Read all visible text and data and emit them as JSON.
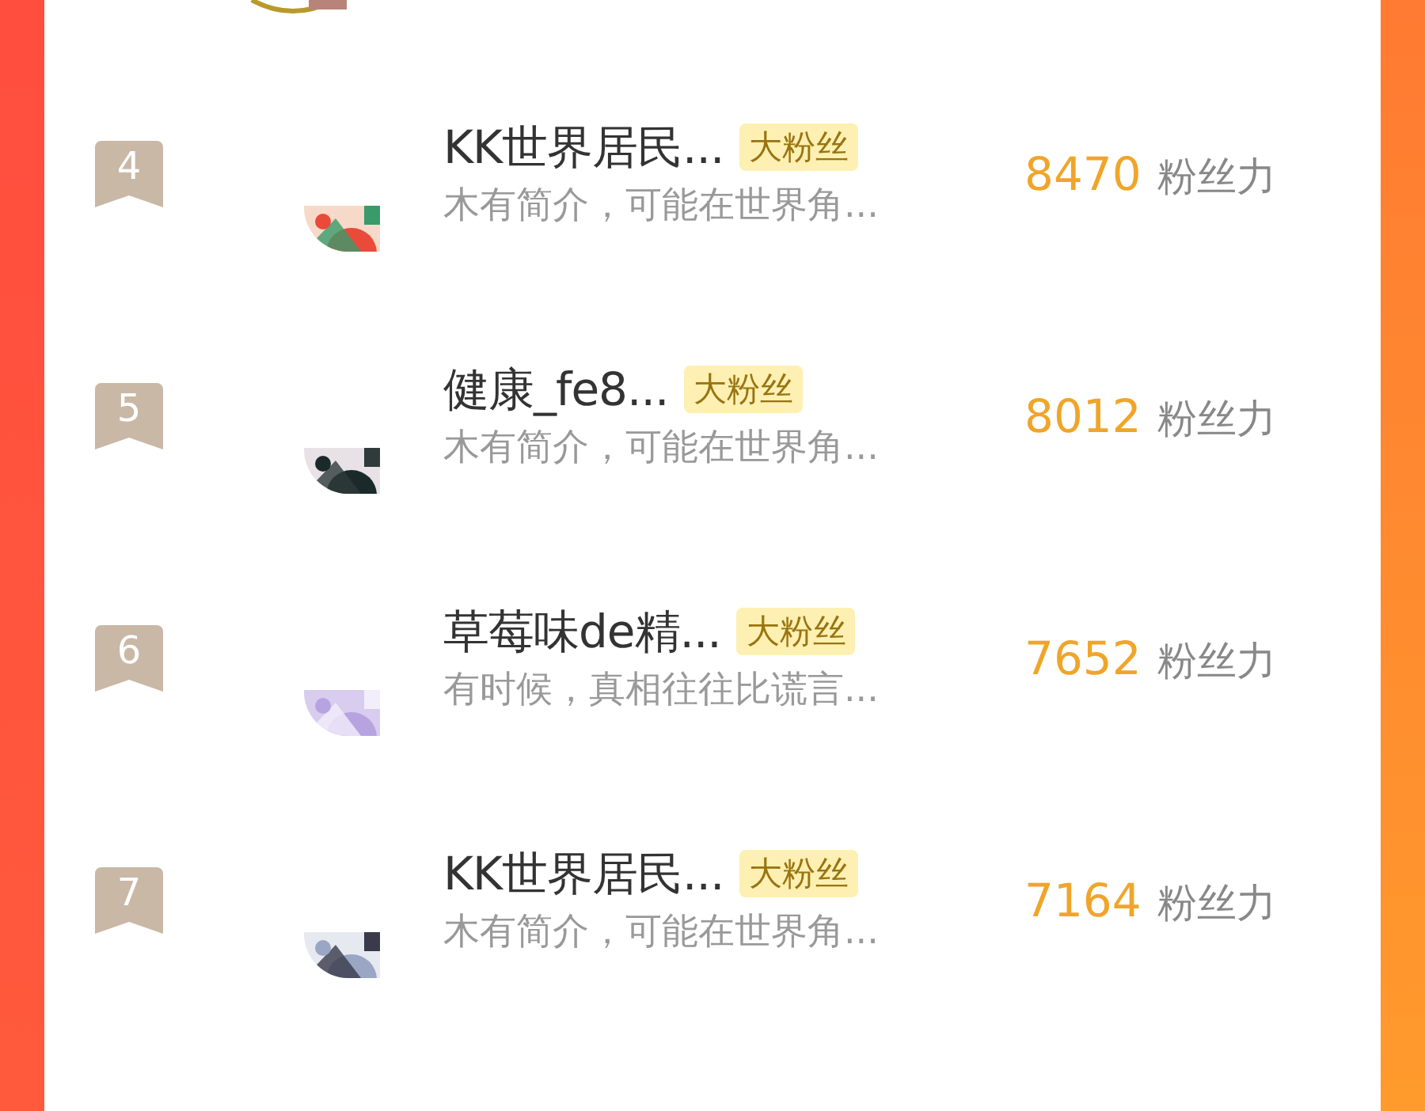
{
  "rows": [
    {
      "rank": "4",
      "name": "KK世界居民...",
      "badge": "大粉丝",
      "bio": "木有简介，可能在世界角...",
      "score": "8470",
      "score_unit": "粉丝力"
    },
    {
      "rank": "5",
      "name": "健康_fe8...",
      "badge": "大粉丝",
      "bio": "木有简介，可能在世界角...",
      "score": "8012",
      "score_unit": "粉丝力"
    },
    {
      "rank": "6",
      "name": "草莓味de精...",
      "badge": "大粉丝",
      "bio": "有时候，真相往往比谎言...",
      "score": "7652",
      "score_unit": "粉丝力"
    },
    {
      "rank": "7",
      "name": "KK世界居民...",
      "badge": "大粉丝",
      "bio": "木有简介，可能在世界角...",
      "score": "7164",
      "score_unit": "粉丝力"
    }
  ]
}
